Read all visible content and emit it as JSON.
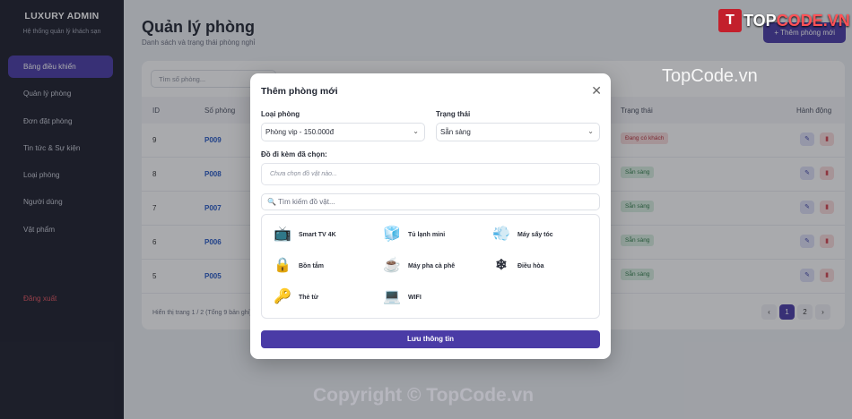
{
  "sidebar": {
    "brand_title": "LUXURY ADMIN",
    "brand_subtitle": "Hệ thống quản lý khách sạn",
    "items": [
      {
        "label": "Bảng điều khiển"
      },
      {
        "label": "Quản lý phòng"
      },
      {
        "label": "Đơn đặt phòng"
      },
      {
        "label": "Tin tức & Sự kiện"
      },
      {
        "label": "Loại phòng"
      },
      {
        "label": "Người dùng"
      },
      {
        "label": "Vật phẩm"
      }
    ],
    "logout": "Đăng xuất"
  },
  "page": {
    "title": "Quản lý phòng",
    "subtitle": "Danh sách và trạng thái phòng nghỉ",
    "add_button": "+ Thêm phòng mới",
    "search_placeholder": "Tìm số phòng..."
  },
  "table": {
    "headers": [
      "ID",
      "Số phòng",
      "Trạng thái",
      "Hành động"
    ],
    "rows": [
      {
        "id": "9",
        "code": "P009",
        "status": "Đang có khách"
      },
      {
        "id": "8",
        "code": "P008",
        "status": "Sẵn sàng"
      },
      {
        "id": "7",
        "code": "P007",
        "status": "Sẵn sàng"
      },
      {
        "id": "6",
        "code": "P006",
        "status": "Sẵn sàng"
      },
      {
        "id": "5",
        "code": "P005",
        "status": "Sẵn sàng"
      }
    ],
    "footer": "Hiển thị trang 1 / 2 (Tổng 9 bản ghi)",
    "pages": [
      "‹",
      "1",
      "2",
      "›"
    ]
  },
  "modal": {
    "title": "Thêm phòng mới",
    "room_type_label": "Loại phòng",
    "room_type_value": "Phòng vip - 150.000đ",
    "status_label": "Trạng thái",
    "status_value": "Sẵn sàng",
    "included_label": "Đồ đi kèm đã chọn:",
    "included_placeholder": "Chưa chọn đồ vật nào...",
    "search_placeholder": "🔍 Tìm kiếm đồ vật...",
    "items": [
      {
        "label": "Smart TV 4K",
        "icon": "tv-icon"
      },
      {
        "label": "Tủ lạnh mini",
        "icon": "fridge-icon"
      },
      {
        "label": "Máy sấy tóc",
        "icon": "hairdryer-icon"
      },
      {
        "label": "Bồn tắm",
        "icon": "lock-icon"
      },
      {
        "label": "Máy pha cà phê",
        "icon": "coffee-icon"
      },
      {
        "label": "Điều hòa",
        "icon": "aircon-icon"
      },
      {
        "label": "Thẻ từ",
        "icon": "keycard-icon"
      },
      {
        "label": "WIFI",
        "icon": "laptop-icon"
      }
    ],
    "save_button": "Lưu thông tin",
    "close": "✕"
  },
  "watermarks": {
    "top": "TopCode.vn",
    "bottom": "Copyright © TopCode.vn",
    "logo_mark": "T",
    "logo_text_a": "TOP",
    "logo_text_b": "CODE.VN"
  },
  "colors": {
    "accent": "#4a3ba6",
    "sidebar_bg": "#1c1e2b",
    "danger": "#e0535e",
    "success": "#2e7b48"
  }
}
